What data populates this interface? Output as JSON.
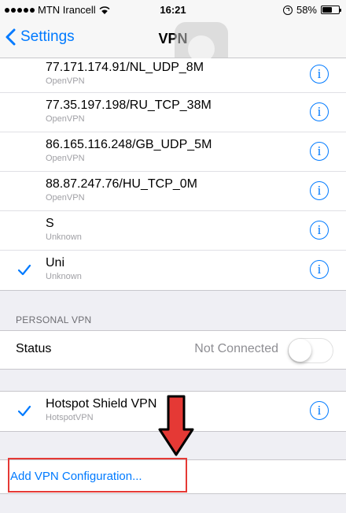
{
  "status_bar": {
    "carrier": "MTN Irancell",
    "time": "16:21",
    "battery": "58%",
    "battery_level": 0.58
  },
  "nav": {
    "back_label": "Settings",
    "title": "VPN"
  },
  "vpn_list": [
    {
      "name": "77.171.174.91/NL_UDP_8M",
      "type": "OpenVPN",
      "checked": false
    },
    {
      "name": "77.35.197.198/RU_TCP_38M",
      "type": "OpenVPN",
      "checked": false
    },
    {
      "name": "86.165.116.248/GB_UDP_5M",
      "type": "OpenVPN",
      "checked": false
    },
    {
      "name": "88.87.247.76/HU_TCP_0M",
      "type": "OpenVPN",
      "checked": false
    },
    {
      "name": "S",
      "type": "Unknown",
      "checked": false
    },
    {
      "name": "Uni",
      "type": "Unknown",
      "checked": true
    }
  ],
  "personal_vpn": {
    "header": "PERSONAL VPN",
    "status_label": "Status",
    "status_value": "Not Connected",
    "toggle_on": false
  },
  "hotspot": {
    "name": "Hotspot Shield VPN",
    "type": "HotspotVPN",
    "checked": true
  },
  "add_config_label": "Add VPN Configuration...",
  "colors": {
    "accent": "#007aff",
    "highlight": "#e53935",
    "background": "#efeff4"
  }
}
